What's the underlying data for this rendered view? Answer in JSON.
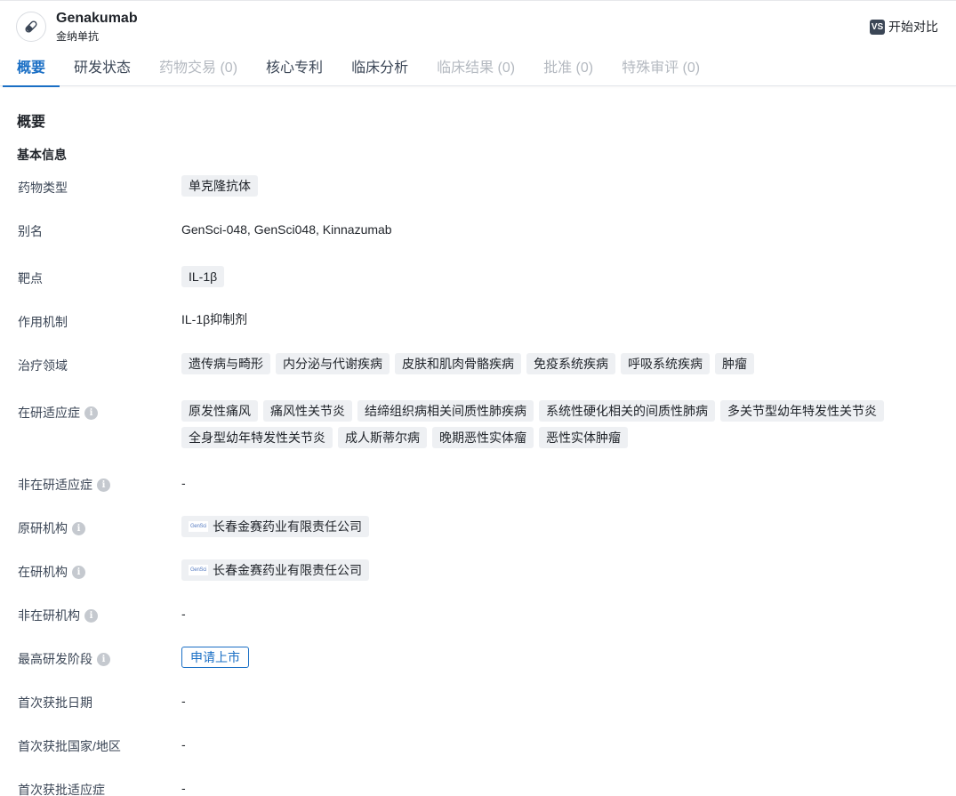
{
  "header": {
    "drug_name": "Genakumab",
    "drug_name_cn": "金纳单抗",
    "compare_badge": "VS",
    "compare_label": "开始对比"
  },
  "tabs": [
    {
      "label": "概要",
      "state": "active"
    },
    {
      "label": "研发状态",
      "state": "normal"
    },
    {
      "label": "药物交易 (0)",
      "state": "disabled"
    },
    {
      "label": "核心专利",
      "state": "normal"
    },
    {
      "label": "临床分析",
      "state": "normal"
    },
    {
      "label": "临床结果 (0)",
      "state": "disabled"
    },
    {
      "label": "批准 (0)",
      "state": "disabled"
    },
    {
      "label": "特殊审评 (0)",
      "state": "disabled"
    }
  ],
  "overview": {
    "section_title": "概要",
    "group_title": "基本信息",
    "drug_type": {
      "label": "药物类型",
      "tags": [
        "单克隆抗体"
      ]
    },
    "alias": {
      "label": "别名",
      "value": "GenSci-048,  GenSci048,  Kinnazumab"
    },
    "target": {
      "label": "靶点",
      "tags": [
        "IL-1β"
      ]
    },
    "mechanism": {
      "label": "作用机制",
      "value": "IL-1β抑制剂"
    },
    "therapeutic_area": {
      "label": "治疗领域",
      "tags": [
        "遗传病与畸形",
        "内分泌与代谢疾病",
        "皮肤和肌肉骨骼疾病",
        "免疫系统疾病",
        "呼吸系统疾病",
        "肿瘤"
      ]
    },
    "active_indications": {
      "label": "在研适应症",
      "tags": [
        "原发性痛风",
        "痛风性关节炎",
        "结缔组织病相关间质性肺疾病",
        "系统性硬化相关的间质性肺病",
        "多关节型幼年特发性关节炎",
        "全身型幼年特发性关节炎",
        "成人斯蒂尔病",
        "晚期恶性实体瘤",
        "恶性实体肿瘤"
      ]
    },
    "inactive_indications": {
      "label": "非在研适应症",
      "value": "-"
    },
    "originator": {
      "label": "原研机构",
      "org": "长春金赛药业有限责任公司",
      "logo_text": "GenSci"
    },
    "active_org": {
      "label": "在研机构",
      "org": "长春金赛药业有限责任公司",
      "logo_text": "GenSci"
    },
    "inactive_org": {
      "label": "非在研机构",
      "value": "-"
    },
    "highest_phase": {
      "label": "最高研发阶段",
      "value": "申请上市"
    },
    "first_approval_date": {
      "label": "首次获批日期",
      "value": "-"
    },
    "first_approval_country": {
      "label": "首次获批国家/地区",
      "value": "-"
    },
    "first_approval_indication": {
      "label": "首次获批适应症",
      "value": "-"
    }
  },
  "colors": {
    "accent": "#1a6fc5",
    "tag_bg": "#eef0f3",
    "disabled_text": "#b4b9c0"
  }
}
